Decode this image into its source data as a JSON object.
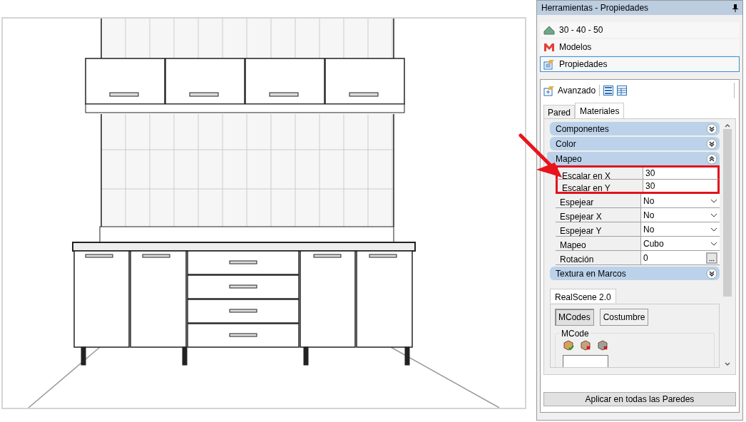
{
  "panel": {
    "title": "Herramientas - Propiedades"
  },
  "nav_items": [
    {
      "label": "30 - 40 - 50",
      "kind": "terrain",
      "selected": false
    },
    {
      "label": "Modelos",
      "kind": "models",
      "selected": false
    },
    {
      "label": "Propiedades",
      "kind": "properties",
      "selected": true
    }
  ],
  "toolbar": {
    "label": "Avanzado"
  },
  "tabs": [
    {
      "label": "Pared",
      "selected": false
    },
    {
      "label": "Materiales",
      "selected": true
    }
  ],
  "sections": [
    {
      "title": "Componentes",
      "expanded": false
    },
    {
      "title": "Color",
      "expanded": false
    },
    {
      "title": "Mapeo",
      "expanded": true,
      "properties": [
        {
          "name": "Escalar en X",
          "value": "30",
          "kind": "text",
          "highlighted": true
        },
        {
          "name": "Escalar en Y",
          "value": "30",
          "kind": "text",
          "highlighted": true
        },
        {
          "name": "Espejear",
          "value": "No",
          "kind": "dropdown",
          "highlighted": false
        },
        {
          "name": "Espejear X",
          "value": "No",
          "kind": "dropdown",
          "highlighted": false
        },
        {
          "name": "Espejear Y",
          "value": "No",
          "kind": "dropdown",
          "highlighted": false
        },
        {
          "name": "Mapeo",
          "value": "Cubo",
          "kind": "dropdown",
          "highlighted": false
        },
        {
          "name": "Rotación",
          "value": "0",
          "kind": "button",
          "highlighted": false
        }
      ]
    },
    {
      "title": "Textura en Marcos",
      "expanded": false
    }
  ],
  "realscene": {
    "tab": "RealScene 2.0",
    "subtabs": [
      {
        "label": "MCodes",
        "selected": true
      },
      {
        "label": "Costumbre",
        "selected": false
      }
    ],
    "group": "MCode"
  },
  "apply_button": "Aplicar en todas las Paredes"
}
